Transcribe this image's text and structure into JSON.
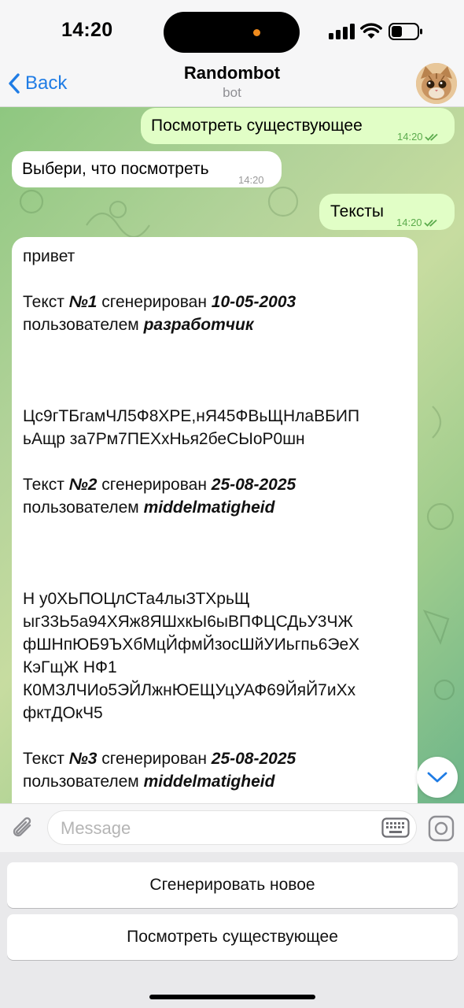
{
  "status": {
    "time": "14:20"
  },
  "header": {
    "back_label": "Back",
    "title": "Randombot",
    "subtitle": "bot"
  },
  "messages": [
    {
      "dir": "out",
      "text": "Посмотреть существующее",
      "time": "14:20"
    },
    {
      "dir": "in",
      "text": "Выбери, что посмотреть",
      "time": "14:20"
    },
    {
      "dir": "out",
      "text": "Тексты",
      "time": "14:20"
    }
  ],
  "long_message": {
    "greeting": "привет",
    "entries": [
      {
        "prefix": "Текст ",
        "num": "№1",
        "mid": " сгенерирован ",
        "date": "10-05-2003",
        "by": "пользователем ",
        "user": "разработчик",
        "body": [
          "Цс9гТБгамЧЛ5Ф8ХРЕ,нЯ45ФВьЩНлаВБИП",
          "ьАщр за7Рм7ПЕХхНья2беСЫоР0шн"
        ]
      },
      {
        "prefix": "Текст ",
        "num": "№2",
        "mid": " сгенерирован ",
        "date": "25-08-2025",
        "by": "пользователем ",
        "user": "middelmatigheid",
        "body": [
          "Н у0ХЬПОЦлСТа4лыЗТХрьЩ",
          "ыг33Ь5а94ХЯж8ЯШхкЫ6ыВПФЦСДьУ3ЧЖ",
          "фШНпЮБ9ЪХбМцЙфмЙзосШйУИьгпь6ЭеХ",
          "КэГщЖ НФ1",
          "К0МЗЛЧИо5ЭЙЛжнЮЕЩУцУАФ69ЙяЙ7иХх",
          "фктДОкЧ5"
        ]
      },
      {
        "prefix": "Текст ",
        "num": "№3",
        "mid": " сгенерирован ",
        "date": "25-08-2025",
        "by": "пользователем ",
        "user": "middelmatigheid"
      }
    ]
  },
  "input": {
    "placeholder": "Message"
  },
  "keyboard": {
    "buttons": [
      "Сгенерировать новое",
      "Посмотреть существующее"
    ]
  },
  "colors": {
    "accent": "#1f7ce5",
    "outgoing_bubble": "#e1fec6",
    "incoming_bubble": "#ffffff",
    "read_check": "#5bab4c"
  },
  "icons": [
    "back-chevron-icon",
    "bot-avatar",
    "double-check-icon",
    "chevron-down-icon",
    "paperclip-icon",
    "keyboard-icon",
    "camera-icon"
  ]
}
